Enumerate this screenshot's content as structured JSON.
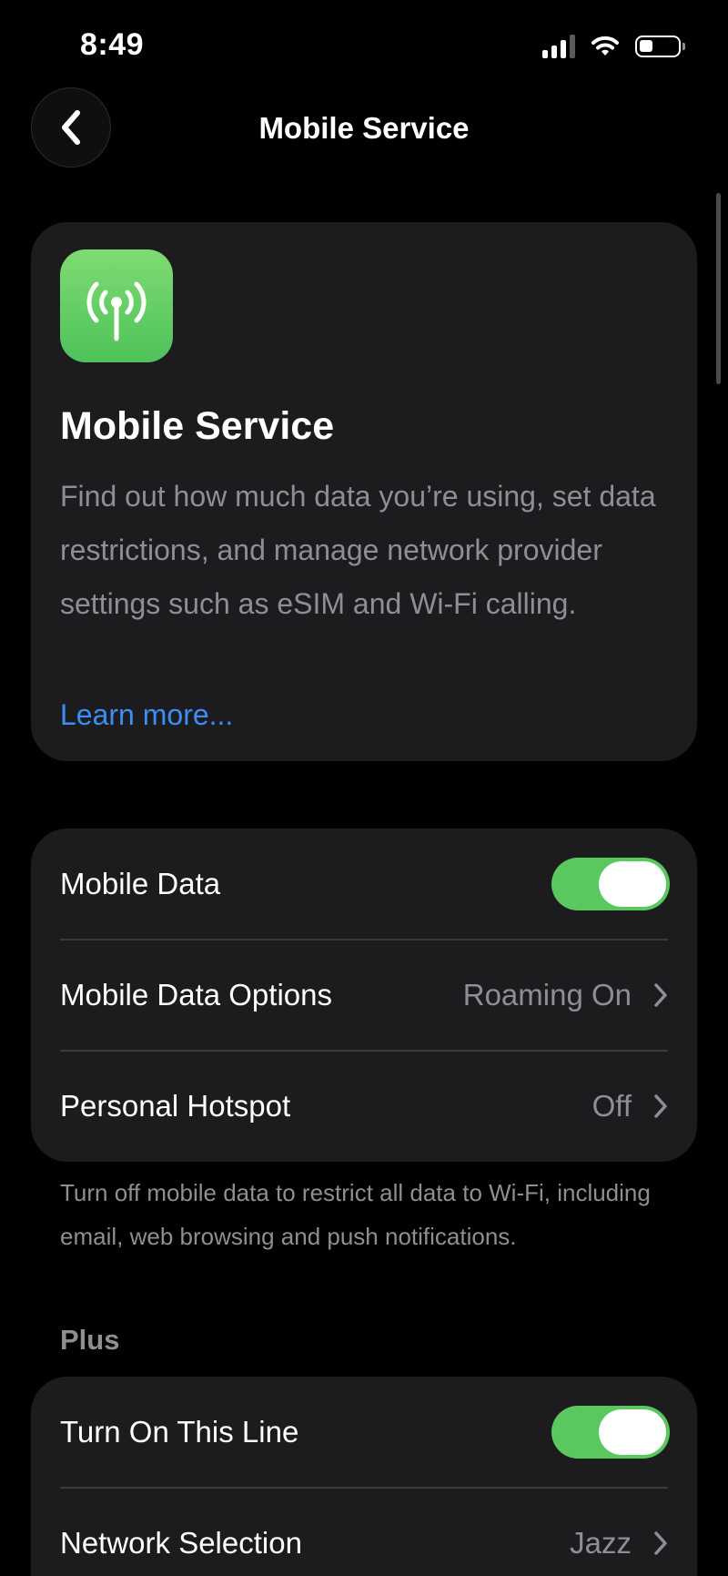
{
  "status_bar": {
    "time": "8:49",
    "signal_bars_active": 3,
    "signal_bars_total": 4,
    "icons": [
      "cellular-signal-icon",
      "wifi-icon",
      "battery-icon"
    ]
  },
  "nav": {
    "title": "Mobile Service",
    "back_icon": "chevron-left-icon"
  },
  "intro": {
    "icon": "antenna-radiowaves-icon",
    "title": "Mobile Service",
    "description": "Find out how much data you’re using, set data restrictions, and manage network provider settings such as eSIM and Wi-Fi calling.",
    "learn_more": "Learn more..."
  },
  "data_group": {
    "rows": [
      {
        "label": "Mobile Data",
        "toggle_on": true
      },
      {
        "label": "Mobile Data Options",
        "value": "Roaming On"
      },
      {
        "label": "Personal Hotspot",
        "value": "Off"
      }
    ],
    "footer": "Turn off mobile data to restrict all data to Wi-Fi, including email, web browsing and push notifications."
  },
  "plus_section": {
    "header": "Plus",
    "rows": [
      {
        "label": "Turn On This Line",
        "toggle_on": true
      },
      {
        "label": "Network Selection",
        "value": "Jazz"
      }
    ]
  },
  "colors": {
    "background": "#000000",
    "card": "#1c1c1e",
    "toggle_on": "#5ac85f",
    "link": "#3b8ef5",
    "secondary_text": "#8e8e93",
    "app_icon_green": "#5ccb5f"
  }
}
